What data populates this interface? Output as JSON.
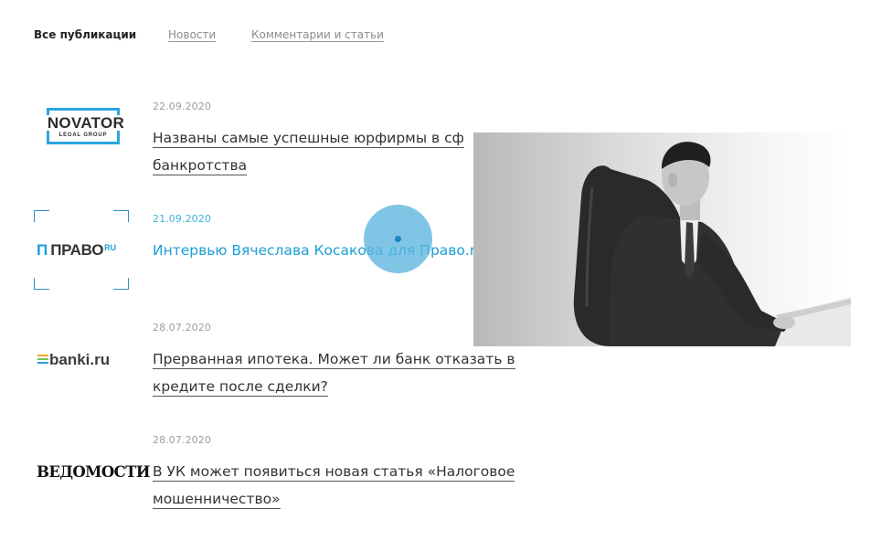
{
  "tabs": {
    "all": "Все публикации",
    "news": "Новости",
    "comments": "Комментарии и статьи"
  },
  "publications": [
    {
      "logo": {
        "name": "NOVATOR",
        "sub": "LEGAL GROUP"
      },
      "date": "22.09.2020",
      "title": "Названы самые успешные юрфирмы в сф... банкротства",
      "title_line1": "Названы самые успешные юрфирмы в сф",
      "title_line2": "банкротства"
    },
    {
      "logo": {
        "mark": "П",
        "name": "ПРАВО",
        "sup": "RU"
      },
      "date": "21.09.2020",
      "title": "Интервью Вячеслава Косакова для Право.ru"
    },
    {
      "logo": {
        "name": "banki.ru"
      },
      "date": "28.07.2020",
      "title_line1": "Прерванная ипотека. Может ли банк отказать в",
      "title_line2": "кредите после сделки?"
    },
    {
      "logo": {
        "name": "ВЕДОМОСТИ"
      },
      "date": "28.07.2020",
      "title_line1": "В УК может появиться новая статья «Налоговое",
      "title_line2": "мошенничество»"
    }
  ],
  "colors": {
    "accent": "#1a9fd6",
    "novator_frame": "#2ba5df",
    "banki_bars": [
      "#f2a22b",
      "#7cc24b",
      "#2f9fd8"
    ]
  },
  "photo": {
    "icon": "person-in-chair-photo"
  }
}
